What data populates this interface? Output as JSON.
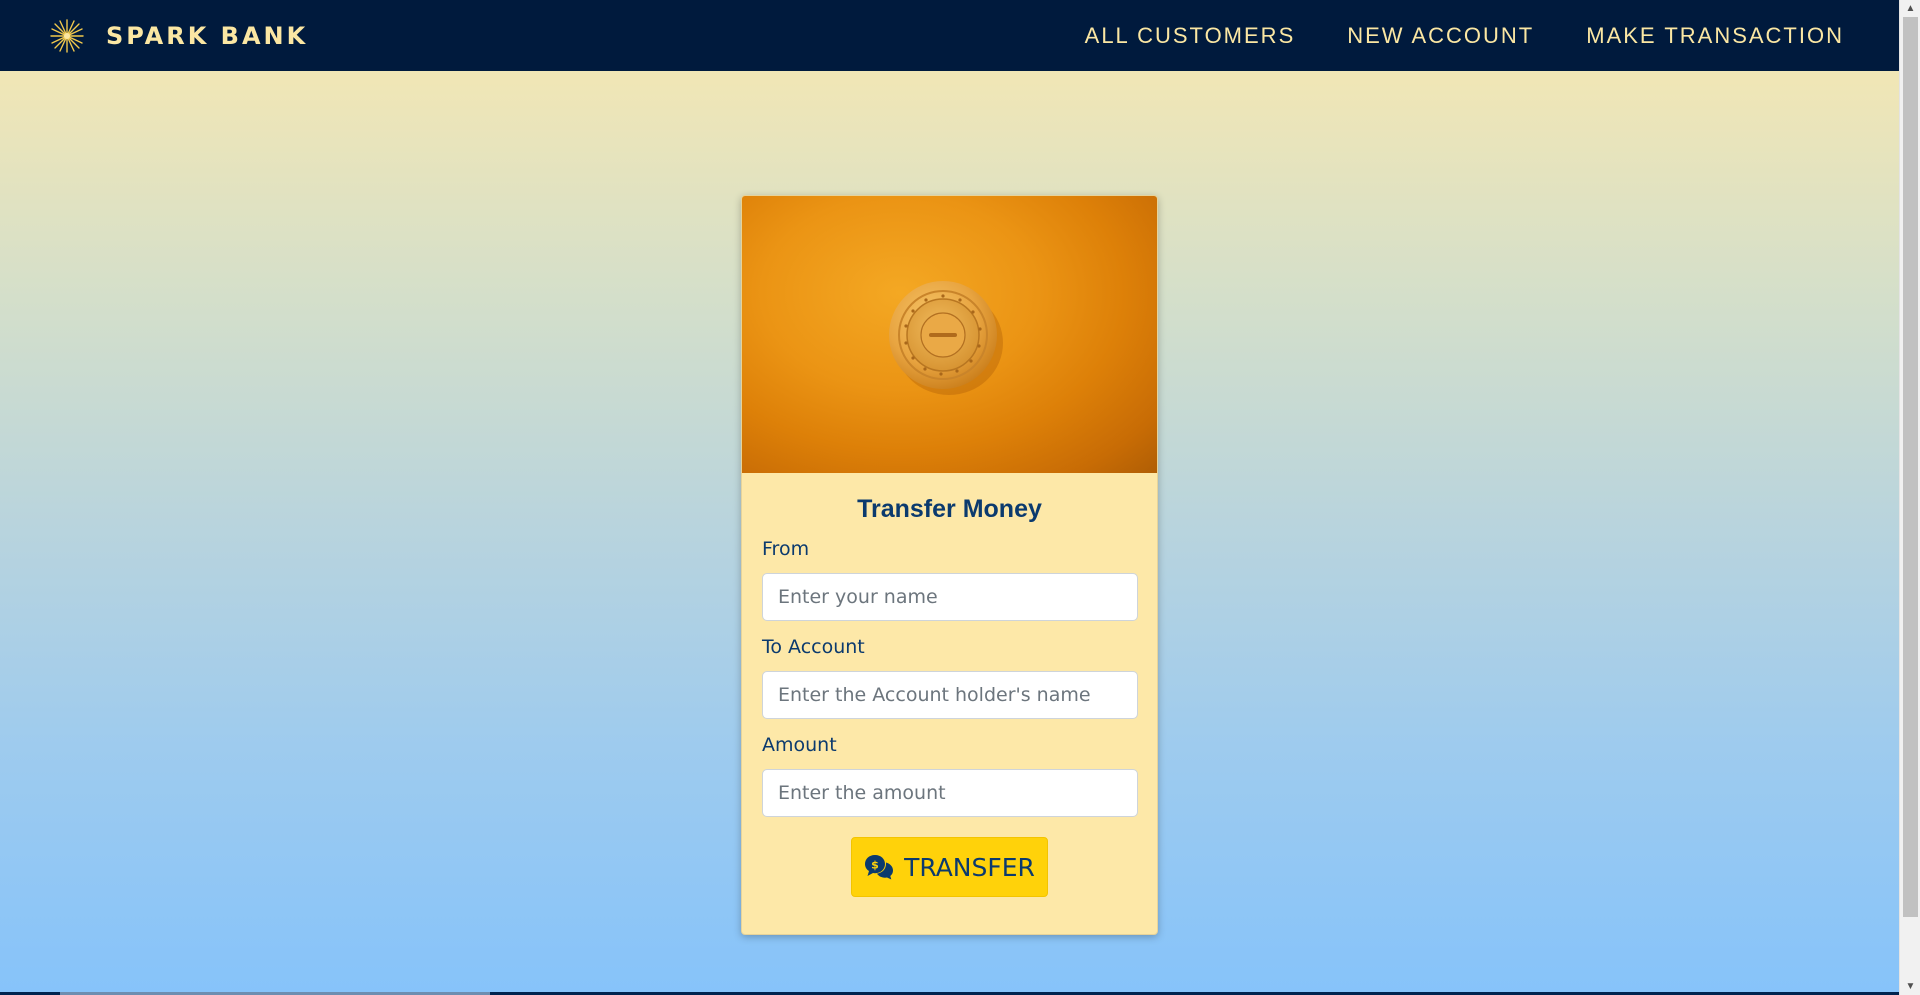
{
  "navbar": {
    "brand_name": "SPARK BANK",
    "brand_icon": "spark-star-icon",
    "links": [
      {
        "label": "ALL CUSTOMERS"
      },
      {
        "label": "NEW ACCOUNT"
      },
      {
        "label": "MAKE TRANSACTION"
      }
    ]
  },
  "card": {
    "image_icon": "safe-dial-icon",
    "title": "Transfer Money",
    "form": {
      "from": {
        "label": "From",
        "placeholder": "Enter your name",
        "value": ""
      },
      "to_account": {
        "label": "To Account",
        "placeholder": "Enter the Account holder's name",
        "value": ""
      },
      "amount": {
        "label": "Amount",
        "placeholder": "Enter the amount",
        "value": ""
      }
    },
    "submit": {
      "label": "TRANSFER",
      "icon": "money-chat-icon"
    }
  },
  "colors": {
    "navbar_bg": "#001a3d",
    "navbar_text": "#fbe7a3",
    "card_bg": "#fde8a8",
    "title_text": "#0b3a6e",
    "button_bg": "#ffd20a",
    "gradient_top": "#f6e8b1",
    "gradient_bottom": "#86c3fa"
  }
}
